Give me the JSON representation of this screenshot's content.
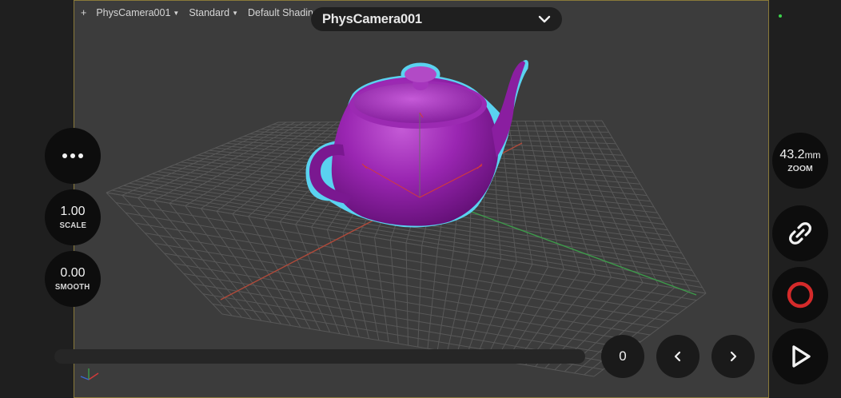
{
  "viewport": {
    "labels": {
      "plus": "+",
      "camera": "PhysCamera001",
      "view": "Standard",
      "shading": "Default Shading"
    }
  },
  "camera_selector": {
    "title": "PhysCamera001"
  },
  "left_controls": {
    "scale": {
      "value": "1.00",
      "label": "SCALE"
    },
    "smooth": {
      "value": "0.00",
      "label": "SMOOTH"
    }
  },
  "right_controls": {
    "zoom": {
      "value": "43.2",
      "unit": "mm",
      "label": "ZOOM"
    }
  },
  "playback": {
    "frame": "0"
  },
  "colors": {
    "teapot": "#8a1ea0",
    "outline": "#5ad2f0",
    "grid": "#5a5a5a",
    "axis_x": "#b04a3a",
    "axis_y": "#3d9a4a",
    "record": "#d42a2a",
    "accent_dot": "#3cd34b"
  },
  "icons": [
    "more-icon",
    "link-icon",
    "record-icon",
    "play-icon",
    "chevron-left-icon",
    "chevron-right-icon",
    "chevron-down-icon",
    "axis-gizmo-icon"
  ]
}
